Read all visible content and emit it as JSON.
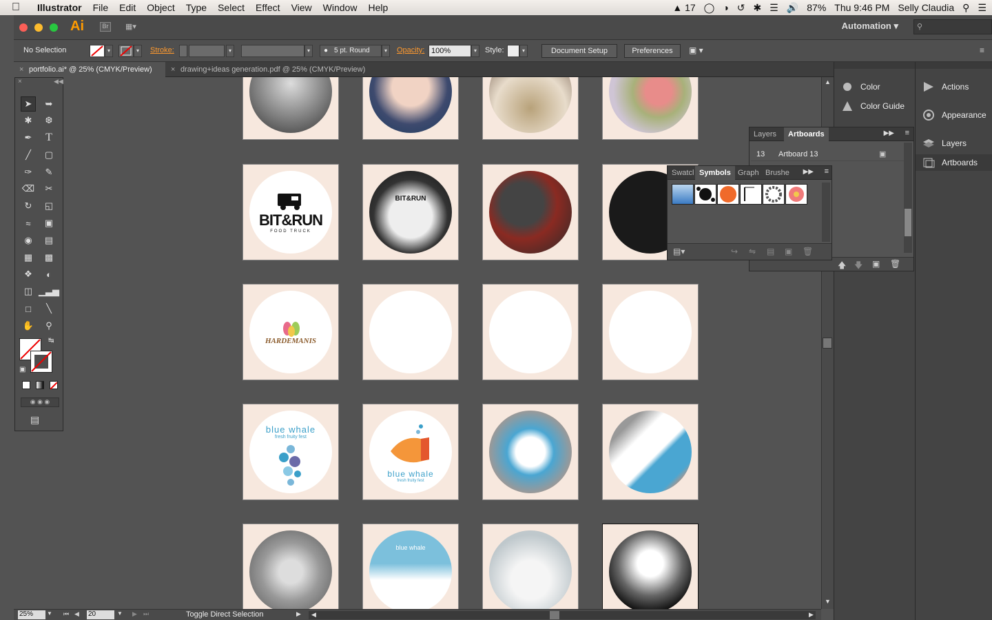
{
  "menubar": {
    "app_name": "Illustrator",
    "menus": [
      "File",
      "Edit",
      "Object",
      "Type",
      "Select",
      "Effect",
      "View",
      "Window",
      "Help"
    ],
    "status_count": "17",
    "battery": "87%",
    "clock": "Thu 9:46 PM",
    "user": "Selly Claudia"
  },
  "appbar": {
    "logo": "Ai",
    "bridge": "Br",
    "workspace": "Automation"
  },
  "control": {
    "selection": "No Selection",
    "stroke_label": "Stroke:",
    "brush": "5 pt. Round",
    "opacity_label": "Opacity:",
    "opacity_value": "100%",
    "style_label": "Style:",
    "doc_setup": "Document Setup",
    "preferences": "Preferences"
  },
  "tabs": [
    {
      "label": "portfolio.ai* @ 25% (CMYK/Preview)"
    },
    {
      "label": "drawing+ideas generation.pdf @ 25% (CMYK/Preview)"
    }
  ],
  "artwork": {
    "bit_run_title": "BIT&RUN",
    "bit_run_sub": "FOOD TRUCK",
    "bit_run_small": "BIT&RUN",
    "hardemanis": "HARDEMANIS",
    "bluewhale1": "blue whale",
    "bluewhale1_sub": "fresh fruity fest",
    "bluewhale2": "blue whale",
    "bluewhale2_sub": "fresh fruity fest",
    "bluewhale3": "blue whale"
  },
  "dock1": [
    {
      "label": "Color",
      "icon": "color-icon"
    },
    {
      "label": "Color Guide",
      "icon": "color-guide-icon"
    }
  ],
  "dock2": [
    {
      "label": "Actions",
      "icon": "actions-icon"
    },
    {
      "label": "Appearance",
      "icon": "appearance-icon"
    },
    {
      "label": "Layers",
      "icon": "layers-icon"
    },
    {
      "label": "Artboards",
      "icon": "artboards-icon"
    }
  ],
  "layers_panel": {
    "tabs": [
      "Layers",
      "Artboards"
    ],
    "row_num": "13",
    "row_name": "Artboard 13"
  },
  "symbols_panel": {
    "tabs": [
      "Swatcl",
      "Symbols",
      "Graph",
      "Brushe"
    ]
  },
  "status": {
    "zoom": "25%",
    "page": "20",
    "tool": "Toggle Direct Selection"
  },
  "colors": {
    "artboard_bg": "#f7e8de",
    "accent_orange": "#ff9a00",
    "ui_dark": "#535353"
  }
}
